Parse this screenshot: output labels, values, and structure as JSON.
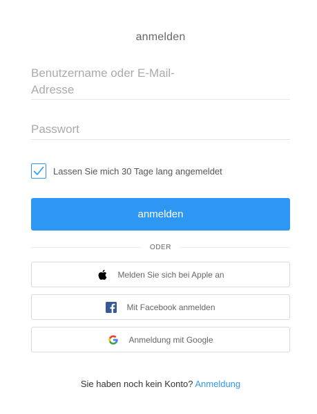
{
  "login": {
    "title": "anmelden",
    "username_placeholder": "Benutzername oder E-Mail-Adresse",
    "password_placeholder": "Passwort",
    "remember_label": "Lassen Sie mich 30 Tage lang angemeldet",
    "remember_checked": true,
    "submit_label": "anmelden",
    "divider_text": "ODER"
  },
  "social": {
    "apple_label": "Melden Sie sich bei Apple an",
    "facebook_label": "Mit Facebook anmelden",
    "google_label": "Anmeldung mit Google",
    "apple_icon": "apple-icon",
    "facebook_icon": "facebook-icon",
    "google_icon": "google-icon"
  },
  "signup": {
    "prompt": "Sie haben noch kein Konto?",
    "link_label": "Anmeldung"
  },
  "colors": {
    "accent": "#2d97f3",
    "facebook_blue": "#3b5998",
    "google_blue": "#4285f4",
    "google_red": "#ea4335",
    "google_yellow": "#fbbc05",
    "google_green": "#34a853",
    "apple_black": "#000000"
  }
}
